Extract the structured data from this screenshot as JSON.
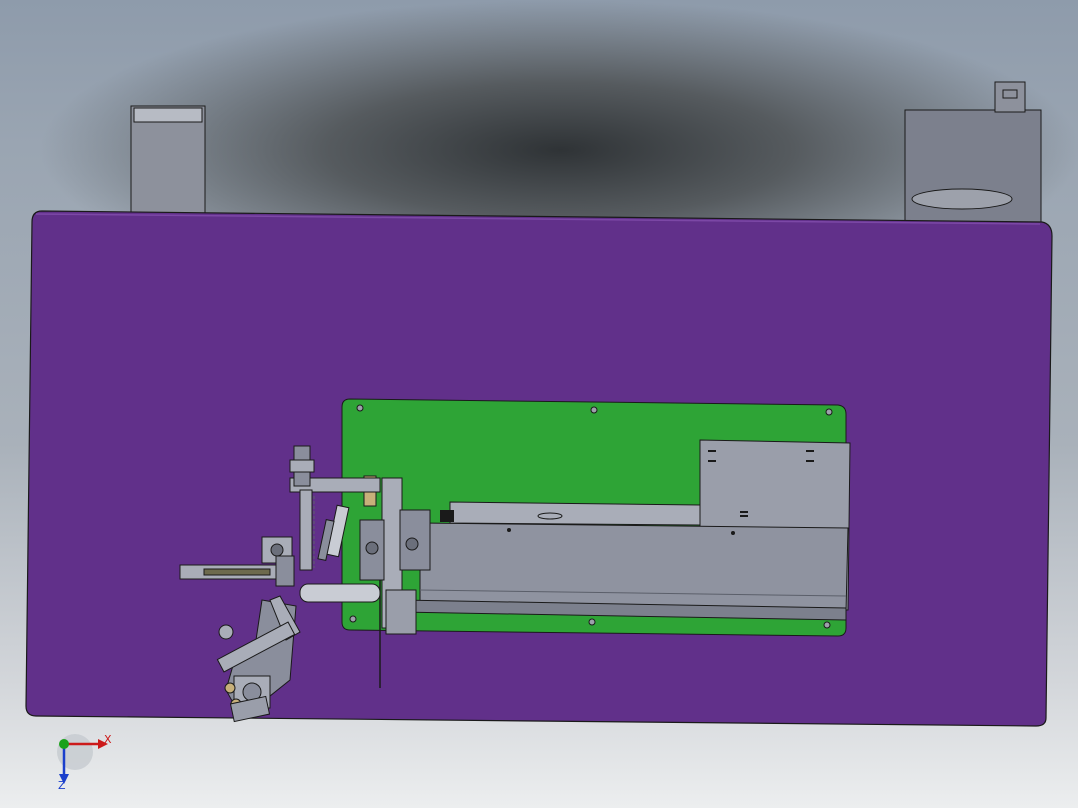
{
  "viewport": {
    "background_top": "#8e9bab",
    "background_bottom": "#eceeef",
    "vignette": "#2f3336"
  },
  "model": {
    "base_plate_color": "#61308a",
    "pcb_color": "#2ea436",
    "metal_color": "#8a8e9c",
    "metal_light": "#a9adb8",
    "edge_color": "#1a1a1a"
  },
  "triad": {
    "x_label": "X",
    "z_label": "Z",
    "x_color": "#cc1a1a",
    "y_color": "#1aa21a",
    "z_color": "#1a3fcc"
  }
}
